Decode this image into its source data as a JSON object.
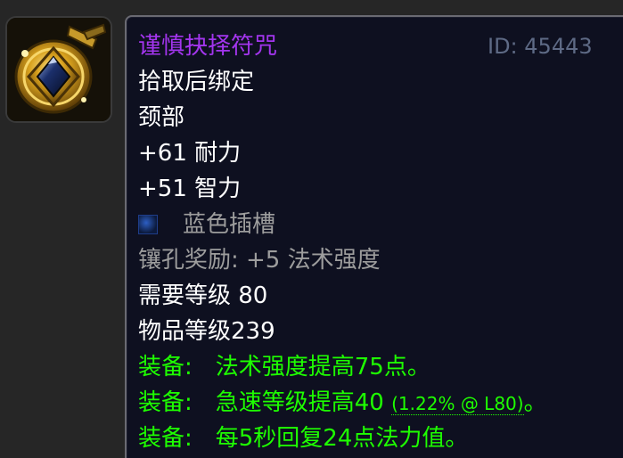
{
  "icon": "gold-amulet-with-blue-gem-icon",
  "tooltip": {
    "name": "谨慎抉择符咒",
    "id_text": "ID: 45443",
    "bind": "拾取后绑定",
    "slot": "颈部",
    "stats": [
      "+61 耐力",
      "+51 智力"
    ],
    "socket": {
      "icon": "blue-socket-icon",
      "label": "蓝色插槽"
    },
    "socket_bonus": "镶孔奖励: +5 法术强度",
    "required_level": "需要等级 80",
    "item_level": "物品等级239",
    "equip": [
      {
        "prefix": "装备:",
        "text": "法术强度提高75点。"
      },
      {
        "prefix": "装备:",
        "text": "急速等级提高40",
        "rating": "(1.22% @ L80)",
        "suffix": "。"
      },
      {
        "prefix": "装备:",
        "text": "每5秒回复24点法力值。"
      }
    ]
  },
  "colors": {
    "epic_name": "#a335ee",
    "equip_green": "#1eff00",
    "socket_gray": "#9d9d9d",
    "background": "#0e1020"
  }
}
